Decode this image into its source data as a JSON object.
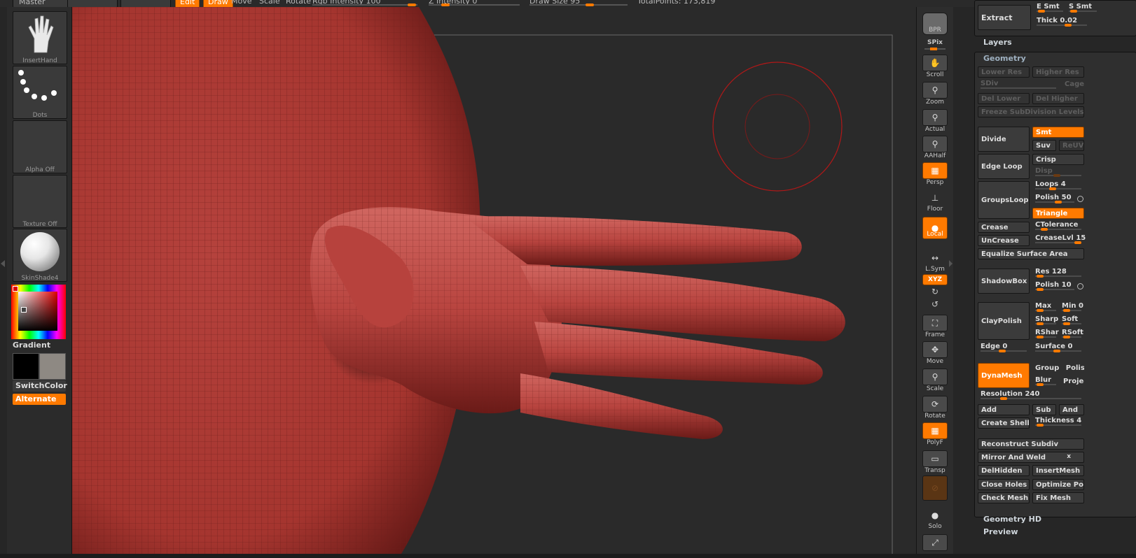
{
  "topbar": {
    "master": "Master",
    "edit": "Edit",
    "draw": "Draw",
    "move": "Move",
    "scale": "Scale",
    "rotate": "Rotate",
    "rgb_intensity": "Rgb Intensity 100",
    "z_intensity": "Z Intensity 0",
    "draw_size": "Draw Size 95",
    "total_points": "TotalPoints: 173,819"
  },
  "left_shelf": {
    "brush": "InsertHand",
    "stroke": "Dots",
    "alpha": "Alpha Off",
    "texture": "Texture Off",
    "material": "SkinShade4",
    "gradient": "Gradient",
    "switch_color": "SwitchColor",
    "alternate": "Alternate"
  },
  "right_tools": {
    "bpr": "BPR",
    "spix": "SPix",
    "scroll": "Scroll",
    "zoom": "Zoom",
    "actual": "Actual",
    "aahalf": "AAHalf",
    "persp": "Persp",
    "floor": "Floor",
    "local": "Local",
    "lsym": "L.Sym",
    "xyz": "XYZ",
    "frame": "Frame",
    "move": "Move",
    "scale": "Scale",
    "rotate": "Rotate",
    "polyf": "PolyF",
    "transp": "Transp",
    "ghost": "Ghost",
    "solo": "Solo"
  },
  "panel": {
    "extract": "Extract",
    "e_smt": "E Smt",
    "s_smt": "S Smt",
    "thick": "Thick 0.02",
    "layers": "Layers",
    "geometry": "Geometry",
    "lower_res": "Lower Res",
    "higher_res": "Higher Res",
    "sdiv": "SDiv",
    "cage": "Cage",
    "del_lower": "Del Lower",
    "del_higher": "Del Higher",
    "freeze": "Freeze SubDivision Levels",
    "divide": "Divide",
    "smt": "Smt",
    "suv": "Suv",
    "reuv": "ReUV",
    "edge_loop": "Edge Loop",
    "crisp": "Crisp",
    "disp": "Disp",
    "groups_loops": "GroupsLoops",
    "loops": "Loops 4",
    "polish50": "Polish 50",
    "triangle": "Triangle",
    "crease": "Crease",
    "ctolerance": "CTolerance",
    "uncrease": "UnCrease",
    "creaselvl": "CreaseLvl 15",
    "equalize": "Equalize Surface Area",
    "shadowbox": "ShadowBox",
    "res128": "Res 128",
    "polish10": "Polish 10",
    "claypolish": "ClayPolish",
    "max": "Max",
    "min0": "Min 0",
    "sharp": "Sharp",
    "soft": "Soft",
    "rshar": "RShar",
    "rsoft": "RSoft",
    "edge0": "Edge 0",
    "surface0": "Surface 0",
    "dynamesh": "DynaMesh",
    "group": "Group",
    "polish": "Polish",
    "blur": "Blur",
    "projec": "Projec",
    "resolution": "Resolution 240",
    "add": "Add",
    "sub": "Sub",
    "and": "And",
    "create_shell": "Create Shell",
    "thickness": "Thickness 4",
    "reconstruct": "Reconstruct Subdiv",
    "mirror_weld": "Mirror And Weld",
    "delhidden": "DelHidden",
    "insertmesh": "InsertMesh",
    "close_holes": "Close Holes",
    "optimize": "Optimize Poi",
    "check_mesh": "Check Mesh",
    "fix_mesh": "Fix Mesh",
    "geometry_hd": "Geometry HD",
    "preview": "Preview"
  },
  "colors": {
    "accent": "#ff7a00",
    "mesh": "#a83a36"
  }
}
